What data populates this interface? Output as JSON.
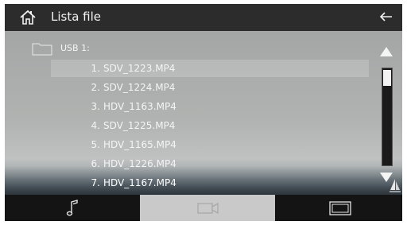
{
  "header": {
    "title": "Lista file",
    "home_icon": "home-icon",
    "back_icon": "back-arrow-icon"
  },
  "folder": {
    "label": "USB 1:",
    "icon": "folder-icon"
  },
  "files": [
    {
      "num": "1.",
      "name": "SDV_1223.MP4"
    },
    {
      "num": "2.",
      "name": "SDV_1224.MP4"
    },
    {
      "num": "3.",
      "name": "HDV_1163.MP4"
    },
    {
      "num": "4.",
      "name": "SDV_1225.MP4"
    },
    {
      "num": "5.",
      "name": "HDV_1165.MP4"
    },
    {
      "num": "6.",
      "name": "HDV_1226.MP4"
    },
    {
      "num": "7.",
      "name": "HDV_1167.MP4"
    }
  ],
  "selected_index": 6,
  "scrollbar": {
    "up_icon": "triangle-up-icon",
    "down_icon": "triangle-down-icon",
    "position": 0
  },
  "bottom_tabs": [
    {
      "id": "music",
      "icon": "music-note-icon",
      "active": false
    },
    {
      "id": "video",
      "icon": "video-camera-icon",
      "active": true
    },
    {
      "id": "photo",
      "icon": "photo-frame-icon",
      "active": false
    }
  ],
  "colors": {
    "active_tab": "#c9c9c9",
    "header_bg": "#2c2c2c",
    "text": "#f4f4f4"
  }
}
